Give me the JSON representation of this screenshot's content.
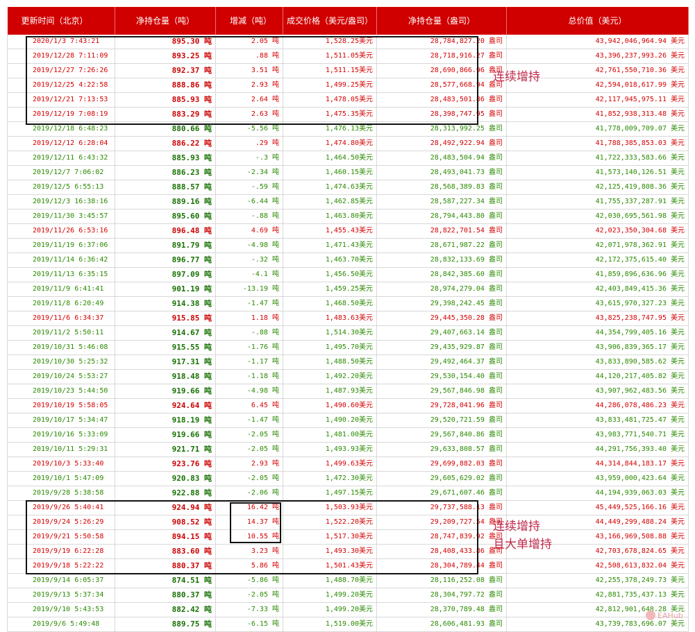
{
  "headers": {
    "time": "更新时间（北京）",
    "ton": "净持仓量（吨）",
    "change": "增减（吨）",
    "price": "成交价格（美元/盎司）",
    "oz": "净持仓量（盎司）",
    "total": "总价值（美元）"
  },
  "units": {
    "ton": "吨",
    "usd": "美元",
    "oz": "盎司"
  },
  "rows": [
    {
      "time": "2020/1/3 7:43:21",
      "ton": "895.30",
      "change": "2.05",
      "price": "1,528.25",
      "oz": "28,784,827.20",
      "total": "43,942,046,964.94",
      "dir": "up"
    },
    {
      "time": "2019/12/28 7:11:09",
      "ton": "893.25",
      "change": ".88",
      "price": "1,511.05",
      "oz": "28,718,916.27",
      "total": "43,396,237,993.26",
      "dir": "up"
    },
    {
      "time": "2019/12/27 7:26:26",
      "ton": "892.37",
      "change": "3.51",
      "price": "1,511.15",
      "oz": "28,690,866.96",
      "total": "42,761,550,710.36",
      "dir": "up"
    },
    {
      "time": "2019/12/25 4:22:58",
      "ton": "888.86",
      "change": "2.93",
      "price": "1,499.25",
      "oz": "28,577,668.94",
      "total": "42,594,018,617.99",
      "dir": "up"
    },
    {
      "time": "2019/12/21 7:13:53",
      "ton": "885.93",
      "change": "2.64",
      "price": "1,478.05",
      "oz": "28,483,501.86",
      "total": "42,117,945,975.11",
      "dir": "up"
    },
    {
      "time": "2019/12/19 7:08:19",
      "ton": "883.29",
      "change": "2.63",
      "price": "1,475.35",
      "oz": "28,398,747.95",
      "total": "41,852,938,313.48",
      "dir": "up"
    },
    {
      "time": "2019/12/18 6:48:23",
      "ton": "880.66",
      "change": "-5.56",
      "price": "1,476.13",
      "oz": "28,313,992.25",
      "total": "41,778,009,709.07",
      "dir": "down"
    },
    {
      "time": "2019/12/12 6:28:04",
      "ton": "886.22",
      "change": ".29",
      "price": "1,474.80",
      "oz": "28,492,922.94",
      "total": "41,788,385,853.03",
      "dir": "up"
    },
    {
      "time": "2019/12/11 6:43:32",
      "ton": "885.93",
      "change": "-.3",
      "price": "1,464.50",
      "oz": "28,483,504.94",
      "total": "41,722,333,583.66",
      "dir": "down"
    },
    {
      "time": "2019/12/7 7:06:02",
      "ton": "886.23",
      "change": "-2.34",
      "price": "1,460.15",
      "oz": "28,493,041.73",
      "total": "41,573,140,126.51",
      "dir": "down"
    },
    {
      "time": "2019/12/5 6:55:13",
      "ton": "888.57",
      "change": "-.59",
      "price": "1,474.63",
      "oz": "28,568,389.83",
      "total": "42,125,419,808.36",
      "dir": "down"
    },
    {
      "time": "2019/12/3 16:38:16",
      "ton": "889.16",
      "change": "-6.44",
      "price": "1,462.85",
      "oz": "28,587,227.34",
      "total": "41,755,337,287.91",
      "dir": "down"
    },
    {
      "time": "2019/11/30 3:45:57",
      "ton": "895.60",
      "change": "-.88",
      "price": "1,463.80",
      "oz": "28,794,443.80",
      "total": "42,030,695,561.98",
      "dir": "down"
    },
    {
      "time": "2019/11/26 6:53:16",
      "ton": "896.48",
      "change": "4.69",
      "price": "1,455.43",
      "oz": "28,822,701.54",
      "total": "42,023,350,304.68",
      "dir": "up"
    },
    {
      "time": "2019/11/19 6:37:06",
      "ton": "891.79",
      "change": "-4.98",
      "price": "1,471.43",
      "oz": "28,671,987.22",
      "total": "42,071,978,362.91",
      "dir": "down"
    },
    {
      "time": "2019/11/14 6:36:42",
      "ton": "896.77",
      "change": "-.32",
      "price": "1,463.70",
      "oz": "28,832,133.69",
      "total": "42,172,375,615.40",
      "dir": "down"
    },
    {
      "time": "2019/11/13 6:35:15",
      "ton": "897.09",
      "change": "-4.1",
      "price": "1,456.50",
      "oz": "28,842,385.60",
      "total": "41,859,896,636.96",
      "dir": "down"
    },
    {
      "time": "2019/11/9 6:41:41",
      "ton": "901.19",
      "change": "-13.19",
      "price": "1,459.25",
      "oz": "28,974,279.04",
      "total": "42,403,849,415.36",
      "dir": "down"
    },
    {
      "time": "2019/11/8 6:20:49",
      "ton": "914.38",
      "change": "-1.47",
      "price": "1,468.50",
      "oz": "29,398,242.45",
      "total": "43,615,970,327.23",
      "dir": "down"
    },
    {
      "time": "2019/11/6 6:34:37",
      "ton": "915.85",
      "change": "1.18",
      "price": "1,483.63",
      "oz": "29,445,350.28",
      "total": "43,825,238,747.95",
      "dir": "up"
    },
    {
      "time": "2019/11/2 5:50:11",
      "ton": "914.67",
      "change": "-.88",
      "price": "1,514.30",
      "oz": "29,407,663.14",
      "total": "44,354,799,405.16",
      "dir": "down"
    },
    {
      "time": "2019/10/31 5:46:08",
      "ton": "915.55",
      "change": "-1.76",
      "price": "1,495.70",
      "oz": "29,435,929.87",
      "total": "43,906,839,365.17",
      "dir": "down"
    },
    {
      "time": "2019/10/30 5:25:32",
      "ton": "917.31",
      "change": "-1.17",
      "price": "1,488.50",
      "oz": "29,492,464.37",
      "total": "43,833,890,585.62",
      "dir": "down"
    },
    {
      "time": "2019/10/24 5:53:27",
      "ton": "918.48",
      "change": "-1.18",
      "price": "1,492.20",
      "oz": "29,530,154.40",
      "total": "44,120,217,405.82",
      "dir": "down"
    },
    {
      "time": "2019/10/23 5:44:50",
      "ton": "919.66",
      "change": "-4.98",
      "price": "1,487.93",
      "oz": "29,567,846.98",
      "total": "43,907,962,483.56",
      "dir": "down"
    },
    {
      "time": "2019/10/19 5:58:05",
      "ton": "924.64",
      "change": "6.45",
      "price": "1,490.60",
      "oz": "29,728,041.96",
      "total": "44,286,078,486.23",
      "dir": "up"
    },
    {
      "time": "2019/10/17 5:34:47",
      "ton": "918.19",
      "change": "-1.47",
      "price": "1,490.20",
      "oz": "29,520,721.59",
      "total": "43,833,481,725.47",
      "dir": "down"
    },
    {
      "time": "2019/10/16 5:33:09",
      "ton": "919.66",
      "change": "-2.05",
      "price": "1,481.00",
      "oz": "29,567,840.86",
      "total": "43,983,771,540.71",
      "dir": "down"
    },
    {
      "time": "2019/10/11 5:29:31",
      "ton": "921.71",
      "change": "-2.05",
      "price": "1,493.93",
      "oz": "29,633,808.57",
      "total": "44,291,756,393.40",
      "dir": "down"
    },
    {
      "time": "2019/10/3 5:33:40",
      "ton": "923.76",
      "change": "2.93",
      "price": "1,499.63",
      "oz": "29,699,882.03",
      "total": "44,314,844,183.17",
      "dir": "up"
    },
    {
      "time": "2019/10/1 5:47:09",
      "ton": "920.83",
      "change": "-2.05",
      "price": "1,472.30",
      "oz": "29,605,629.02",
      "total": "43,959,000,423.64",
      "dir": "down"
    },
    {
      "time": "2019/9/28 5:38:58",
      "ton": "922.88",
      "change": "-2.06",
      "price": "1,497.15",
      "oz": "29,671,607.46",
      "total": "44,194,939,063.03",
      "dir": "down"
    },
    {
      "time": "2019/9/26 5:40:41",
      "ton": "924.94",
      "change": "16.42",
      "price": "1,503.93",
      "oz": "29,737,588.13",
      "total": "45,449,525,166.16",
      "dir": "up"
    },
    {
      "time": "2019/9/24 5:26:29",
      "ton": "908.52",
      "change": "14.37",
      "price": "1,522.20",
      "oz": "29,209,727.54",
      "total": "44,449,299,488.24",
      "dir": "up"
    },
    {
      "time": "2019/9/21 5:50:58",
      "ton": "894.15",
      "change": "10.55",
      "price": "1,517.30",
      "oz": "28,747,839.92",
      "total": "43,166,969,508.88",
      "dir": "up"
    },
    {
      "time": "2019/9/19 6:22:28",
      "ton": "883.60",
      "change": "3.23",
      "price": "1,493.30",
      "oz": "28,408,433.86",
      "total": "42,703,678,824.65",
      "dir": "up"
    },
    {
      "time": "2019/9/18 5:22:22",
      "ton": "880.37",
      "change": "5.86",
      "price": "1,501.43",
      "oz": "28,304,789.44",
      "total": "42,508,613,832.04",
      "dir": "up"
    },
    {
      "time": "2019/9/14 6:05:37",
      "ton": "874.51",
      "change": "-5.86",
      "price": "1,488.70",
      "oz": "28,116,252.08",
      "total": "42,255,378,249.73",
      "dir": "down"
    },
    {
      "time": "2019/9/13 5:37:34",
      "ton": "880.37",
      "change": "-2.05",
      "price": "1,499.20",
      "oz": "28,304,797.72",
      "total": "42,881,735,437.13",
      "dir": "down"
    },
    {
      "time": "2019/9/10 5:43:53",
      "ton": "882.42",
      "change": "-7.33",
      "price": "1,499.20",
      "oz": "28,370,789.48",
      "total": "42,812,901,648.28",
      "dir": "down"
    },
    {
      "time": "2019/9/6 5:49:48",
      "ton": "889.75",
      "change": "-6.15",
      "price": "1,519.00",
      "oz": "28,606,481.93",
      "total": "43,739,783,696.07",
      "dir": "down"
    }
  ],
  "annotations": {
    "top": "连续增持",
    "bottom_line1": "连续增持",
    "bottom_line2": "且大单增持"
  },
  "watermark": "EAHub"
}
